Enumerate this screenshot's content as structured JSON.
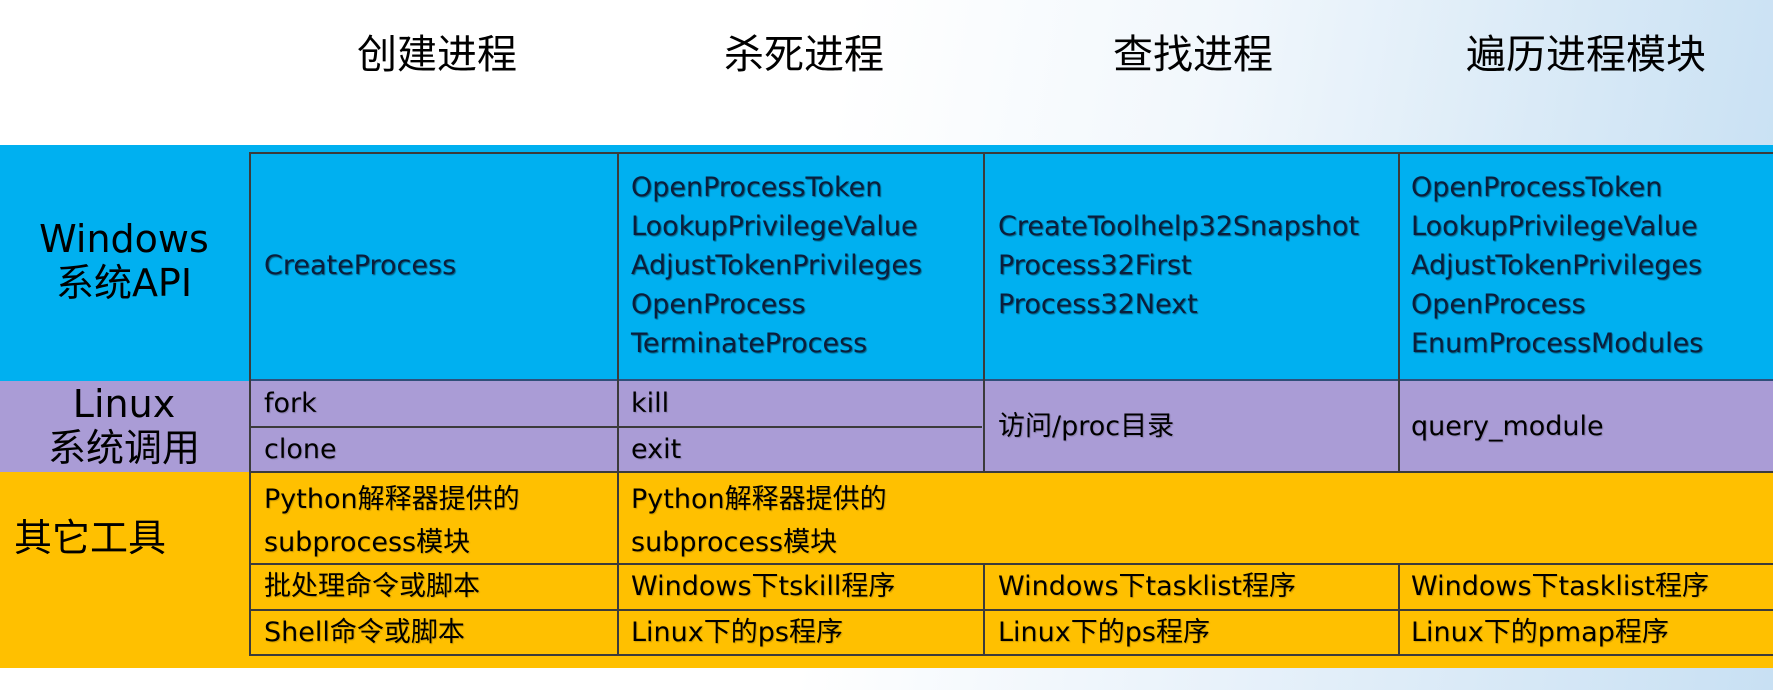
{
  "columns": [
    "创建进程",
    "杀死进程",
    "查找进程",
    "遍历进程模块"
  ],
  "rows": {
    "windows": {
      "label_line1": "Windows",
      "label_line2": "系统API",
      "create": [
        "CreateProcess"
      ],
      "kill": [
        "OpenProcessToken",
        "LookupPrivilegeValue",
        "AdjustTokenPrivileges",
        "OpenProcess",
        "TerminateProcess"
      ],
      "find": [
        "CreateToolhelp32Snapshot",
        "Process32First",
        "Process32Next"
      ],
      "modules": [
        "OpenProcessToken",
        "LookupPrivilegeValue",
        "AdjustTokenPrivileges",
        "OpenProcess",
        "EnumProcessModules"
      ]
    },
    "linux": {
      "label_line1": "Linux",
      "label_line2": "系统调用",
      "create": [
        "fork",
        "clone"
      ],
      "kill": [
        "kill",
        "exit"
      ],
      "find": "访问/proc目录",
      "modules": "query_module"
    },
    "other": {
      "label": "其它工具",
      "create": [
        "Python解释器提供的",
        "subprocess模块",
        "批处理命令或脚本",
        "Shell命令或脚本"
      ],
      "kill": [
        "Python解释器提供的",
        "subprocess模块",
        "Windows下tskill程序",
        "Linux下的ps程序"
      ],
      "find": [
        "Windows下tasklist程序",
        "Linux下的ps程序"
      ],
      "modules": [
        "Windows下tasklist程序",
        "Linux下的pmap程序"
      ]
    }
  }
}
